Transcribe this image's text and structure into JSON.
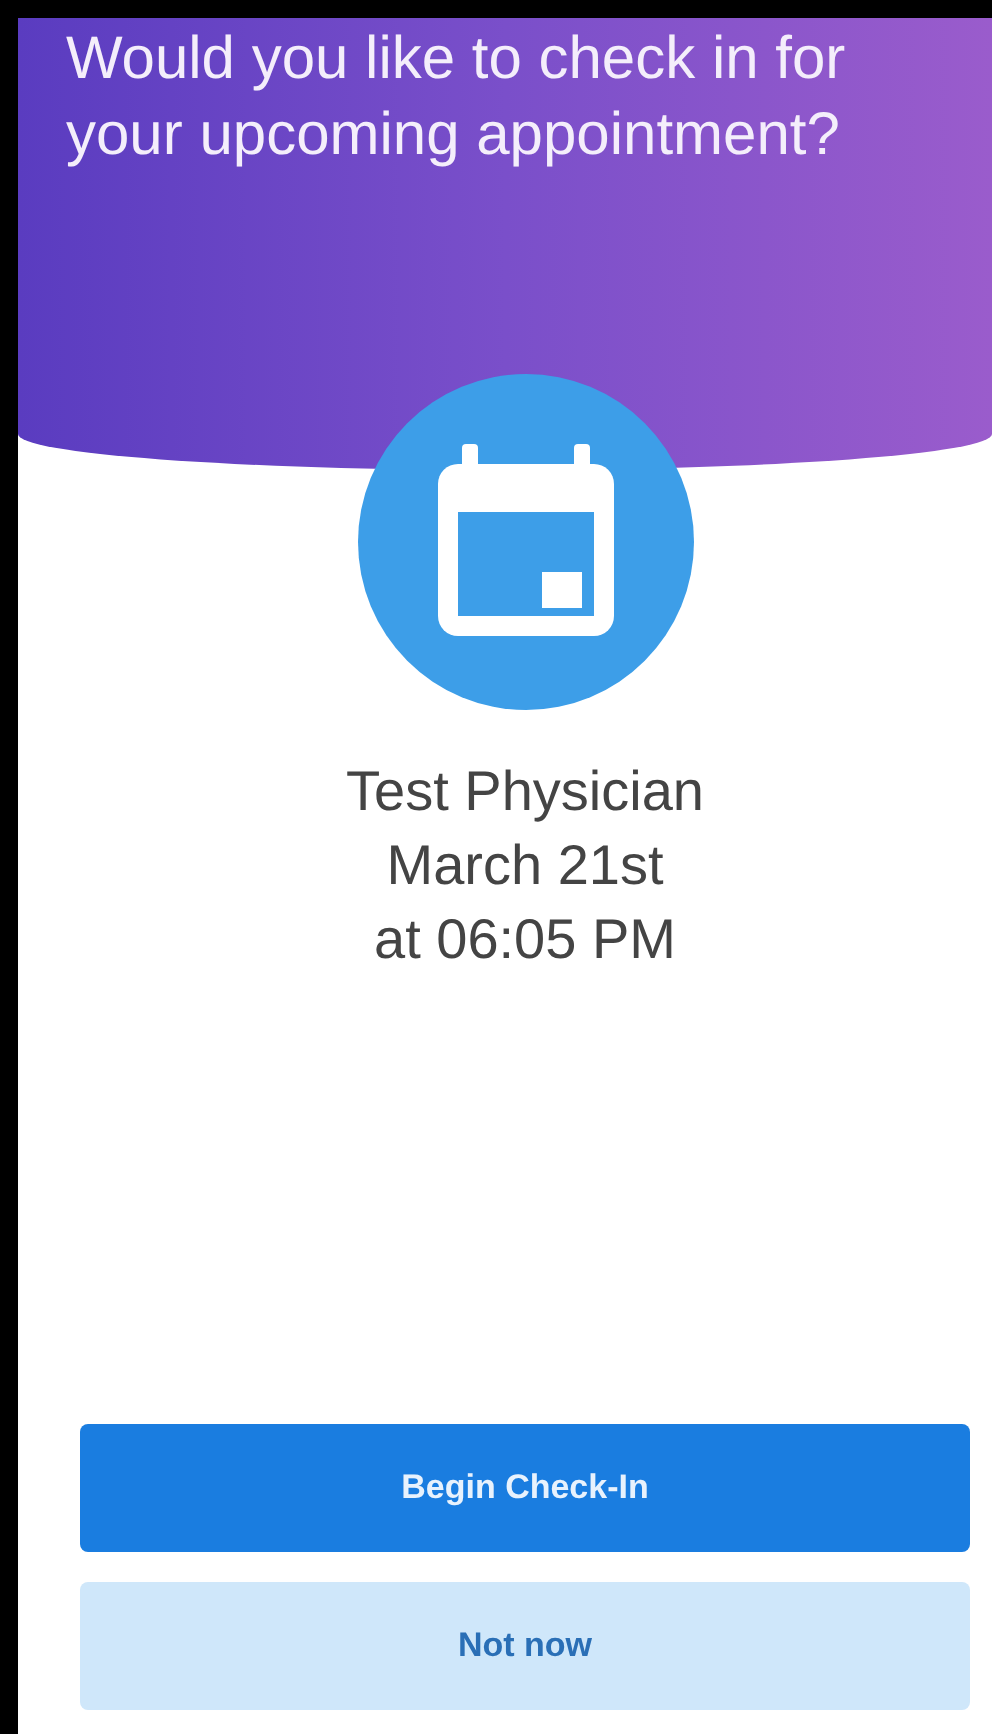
{
  "header": {
    "title": "Would you like to check in for your upcoming appointment?"
  },
  "appointment": {
    "lines": [
      "Test Physician",
      "March 21st",
      "at 06:05 PM"
    ]
  },
  "buttons": [
    {
      "label": "Begin Check-In",
      "kind": "primary"
    },
    {
      "label": "Not now",
      "kind": "secondary"
    }
  ]
}
